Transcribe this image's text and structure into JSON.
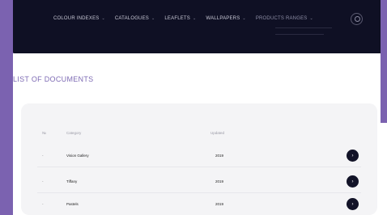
{
  "nav": {
    "items": [
      {
        "label": "COLOUR INDEXES",
        "chevron": "⌄"
      },
      {
        "label": "CATALOGUES",
        "chevron": "⌄"
      },
      {
        "label": "LEAFLETS",
        "chevron": "⌄"
      },
      {
        "label": "WALLPAPERS",
        "chevron": "⌄"
      },
      {
        "label": "PRODUCTS RANGES",
        "chevron": "⌄"
      }
    ]
  },
  "page": {
    "heading": "LIST OF DOCUMENTS"
  },
  "table": {
    "headers": {
      "num": "№",
      "category": "Category",
      "updated": "Updated"
    },
    "rows": [
      {
        "num": "-",
        "category": "Vision Gallery",
        "updated": "2019",
        "action_icon": "chevron-right-icon"
      },
      {
        "num": "-",
        "category": "Tiffany",
        "updated": "2019",
        "action_icon": "chevron-right-icon"
      },
      {
        "num": "-",
        "category": "Pastels",
        "updated": "2019",
        "action_icon": "chevron-right-icon"
      }
    ]
  },
  "colors": {
    "navbar": "#0f1024",
    "background": "#7b62b0",
    "heading": "#7e6bb4",
    "action_button": "#121328"
  }
}
